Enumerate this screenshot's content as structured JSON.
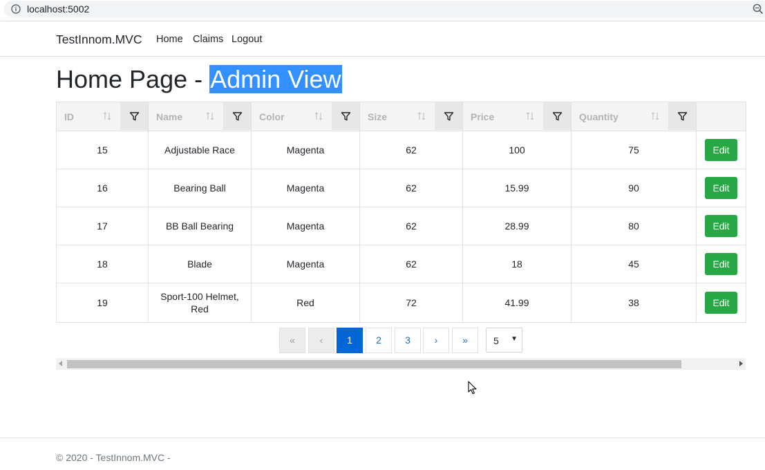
{
  "browser": {
    "url": "localhost:5002"
  },
  "navbar": {
    "brand": "TestInnom.MVC",
    "links": [
      "Home",
      "Claims",
      "Logout"
    ]
  },
  "page": {
    "title_prefix": "Home Page - ",
    "title_highlight": "Admin View"
  },
  "table": {
    "columns": [
      "ID",
      "Name",
      "Color",
      "Size",
      "Price",
      "Quantity"
    ],
    "edit_label": "Edit",
    "rows": [
      [
        "15",
        "Adjustable Race",
        "Magenta",
        "62",
        "100",
        "75"
      ],
      [
        "16",
        "Bearing Ball",
        "Magenta",
        "62",
        "15.99",
        "90"
      ],
      [
        "17",
        "BB Ball Bearing",
        "Magenta",
        "62",
        "28.99",
        "80"
      ],
      [
        "18",
        "Blade",
        "Magenta",
        "62",
        "18",
        "45"
      ],
      [
        "19",
        "Sport-100 Helmet, Red",
        "Red",
        "72",
        "41.99",
        "38"
      ]
    ]
  },
  "pager": {
    "first": "«",
    "prev": "‹",
    "pages": [
      "1",
      "2",
      "3"
    ],
    "current_page": "1",
    "next": "›",
    "last": "»",
    "page_size": "5"
  },
  "footer": {
    "text": "© 2020 - TestInnom.MVC -"
  },
  "colors": {
    "accent": "#0366d6",
    "edit": "#28a745",
    "highlight": "#3390ff"
  },
  "icons": [
    "info-icon",
    "zoom-icon",
    "sort-icon",
    "filter-icon",
    "mouse-cursor-icon"
  ]
}
